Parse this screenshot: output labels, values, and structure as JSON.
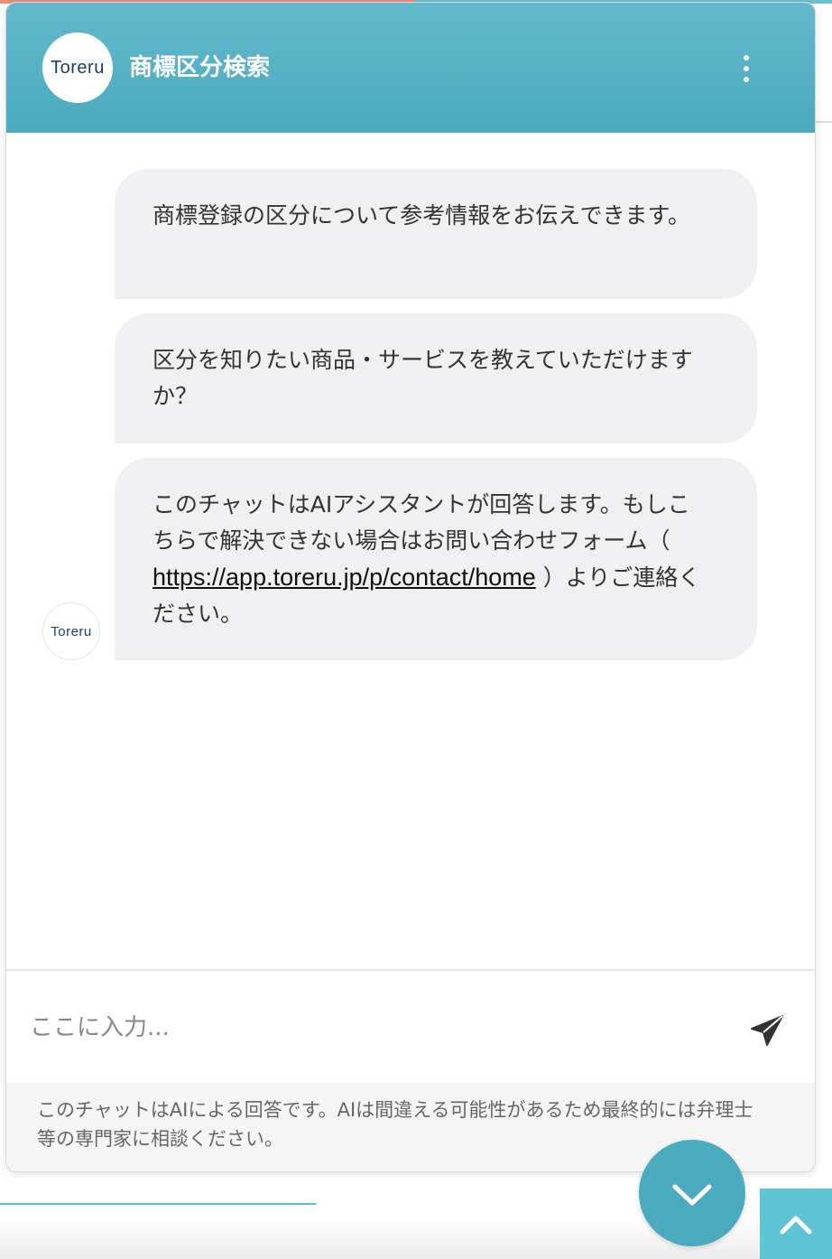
{
  "header": {
    "logo_text": "Toreru",
    "title": "商標区分検索"
  },
  "messages": [
    {
      "text": "商標登録の区分について参考情報をお伝えできます。"
    },
    {
      "text": "区分を知りたい商品・サービスを教えていただけますか？"
    },
    {
      "text_before": "このチャットはAIアシスタントが回答します。もしこちらで解決できない場合はお問い合わせフォーム（",
      "link": "https://app.toreru.jp/p/contact/home",
      "text_after": "）よりご連絡ください。"
    }
  ],
  "input": {
    "placeholder": "ここに入力..."
  },
  "disclaimer": "このチャットはAIによる回答です。AIは間違える可能性があるため最終的には弁理士等の専門家に相談ください。",
  "colors": {
    "header_top": "#64b9cc",
    "header_bottom": "#4aaabe",
    "bubble_bg": "#f0f0f2",
    "accent": "#5ec3d5"
  },
  "icons": {
    "menu": "kebab-menu-icon",
    "send": "paper-plane-icon",
    "collapse": "chevron-down-icon",
    "scroll_top": "chevron-up-icon"
  }
}
